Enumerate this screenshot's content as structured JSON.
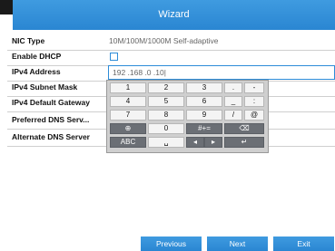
{
  "window": {
    "title": "Wizard"
  },
  "form": {
    "nic_type": {
      "label": "NIC Type",
      "value": "10M/100M/1000M Self-adaptive"
    },
    "enable_dhcp": {
      "label": "Enable DHCP"
    },
    "ipv4_address": {
      "label": "IPv4 Address",
      "value": "192 .168 .0    .10|"
    },
    "ipv4_subnet_mask": {
      "label": "IPv4 Subnet Mask"
    },
    "ipv4_default_gateway": {
      "label": "IPv4 Default Gateway"
    },
    "preferred_dns": {
      "label": "Preferred DNS Serv..."
    },
    "alternate_dns": {
      "label": "Alternate DNS Server"
    }
  },
  "keyboard": {
    "row1": [
      "1",
      "2",
      "3",
      ".",
      "-"
    ],
    "row2": [
      "4",
      "5",
      "6",
      "_",
      ":"
    ],
    "row3": [
      "7",
      "8",
      "9",
      "/",
      "@"
    ],
    "row4": {
      "globe": "⊕",
      "zero": "0",
      "symbols": "#+=",
      "backspace": "⌫"
    },
    "row5": {
      "abc": "ABC",
      "space": "␣",
      "left": "◂",
      "right": "▸",
      "enter": "↵"
    }
  },
  "footer": {
    "previous": "Previous",
    "next": "Next",
    "exit": "Exit"
  },
  "colors": {
    "accent": "#2d8cd8",
    "title_bar": "#3a96dd"
  }
}
